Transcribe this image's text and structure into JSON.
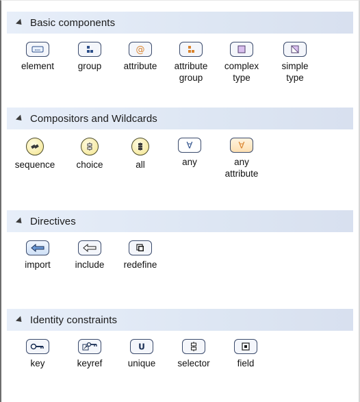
{
  "sections": [
    {
      "title": "Basic components",
      "items": [
        {
          "label": "element"
        },
        {
          "label": "group"
        },
        {
          "label": "attribute"
        },
        {
          "label": "attribute\ngroup"
        },
        {
          "label": "complex\ntype"
        },
        {
          "label": "simple\ntype"
        }
      ]
    },
    {
      "title": "Compositors and Wildcards",
      "items": [
        {
          "label": "sequence"
        },
        {
          "label": "choice"
        },
        {
          "label": "all"
        },
        {
          "label": "any"
        },
        {
          "label": "any\nattribute"
        }
      ]
    },
    {
      "title": "Directives",
      "items": [
        {
          "label": "import"
        },
        {
          "label": "include"
        },
        {
          "label": "redefine"
        }
      ]
    },
    {
      "title": "Identity constraints",
      "items": [
        {
          "label": "key"
        },
        {
          "label": "keyref"
        },
        {
          "label": "unique"
        },
        {
          "label": "selector"
        },
        {
          "label": "field"
        }
      ]
    }
  ],
  "icons": {
    "element": "element-icon",
    "group": "group-icon",
    "attribute": "attribute-icon",
    "attribute_group": "attribute-group-icon",
    "complex_type": "complex-type-icon",
    "simple_type": "simple-type-icon",
    "sequence": "sequence-icon",
    "choice": "choice-icon",
    "all": "all-icon",
    "any": "any-icon",
    "any_attribute": "any-attribute-icon",
    "import": "import-icon",
    "include": "include-icon",
    "redefine": "redefine-icon",
    "key": "key-icon",
    "keyref": "keyref-icon",
    "unique": "unique-icon",
    "selector": "selector-icon",
    "field": "field-icon"
  },
  "colors": {
    "header_bg": "#dde6f3",
    "blue_icon": "#b6d0f3",
    "orange_icon": "#fdd9a3",
    "purple_icon": "#e2ccf1",
    "yellow_icon": "#f3e48a"
  }
}
